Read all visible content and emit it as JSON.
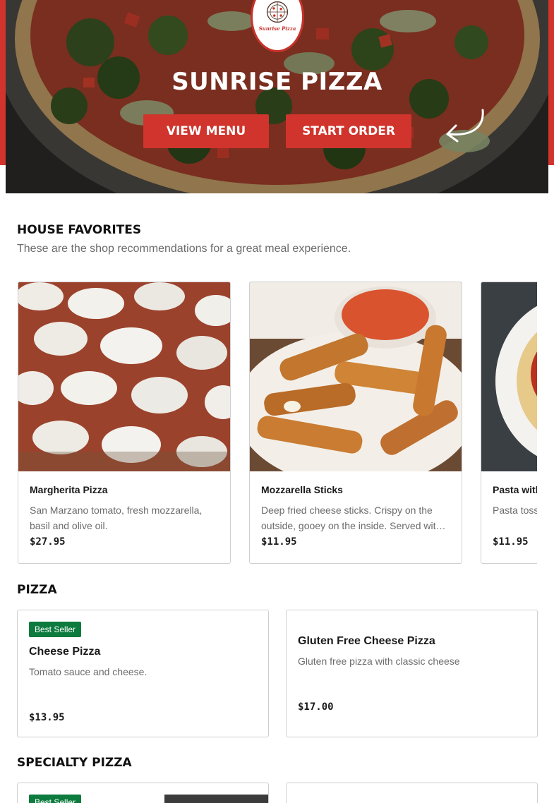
{
  "hero": {
    "logo_text": "Sunrise Pizza",
    "title": "SUNRISE PIZZA",
    "view_menu_label": "VIEW MENU",
    "start_order_label": "START ORDER",
    "accent_color": "#d0342c"
  },
  "favorites": {
    "title": "HOUSE FAVORITES",
    "description": "These are the shop recommendations for a great meal experience.",
    "items": [
      {
        "name": "Margherita Pizza",
        "description": "San Marzano tomato, fresh mozzarella, basil and olive oil.",
        "price": "$27.95"
      },
      {
        "name": "Mozzarella Sticks",
        "description": "Deep fried cheese sticks. Crispy on the outside, gooey on the inside. Served wit…",
        "price": "$11.95"
      },
      {
        "name": "Pasta with Marinara",
        "description": "Pasta tossed in marinara sauce.",
        "price": "$11.95"
      }
    ]
  },
  "pizza": {
    "title": "PIZZA",
    "items": [
      {
        "badge": "Best Seller",
        "name": "Cheese Pizza",
        "description": "Tomato sauce and cheese.",
        "price": "$13.95"
      },
      {
        "name": "Gluten Free Cheese Pizza",
        "description": "Gluten free pizza with classic cheese",
        "price": "$17.00"
      }
    ]
  },
  "specialty": {
    "title": "SPECIALTY PIZZA",
    "items": [
      {
        "badge": "Best Seller"
      }
    ]
  },
  "colors": {
    "brand_red": "#d0342c",
    "badge_green": "#0d7a3e",
    "text_muted": "#6b6b6b"
  }
}
